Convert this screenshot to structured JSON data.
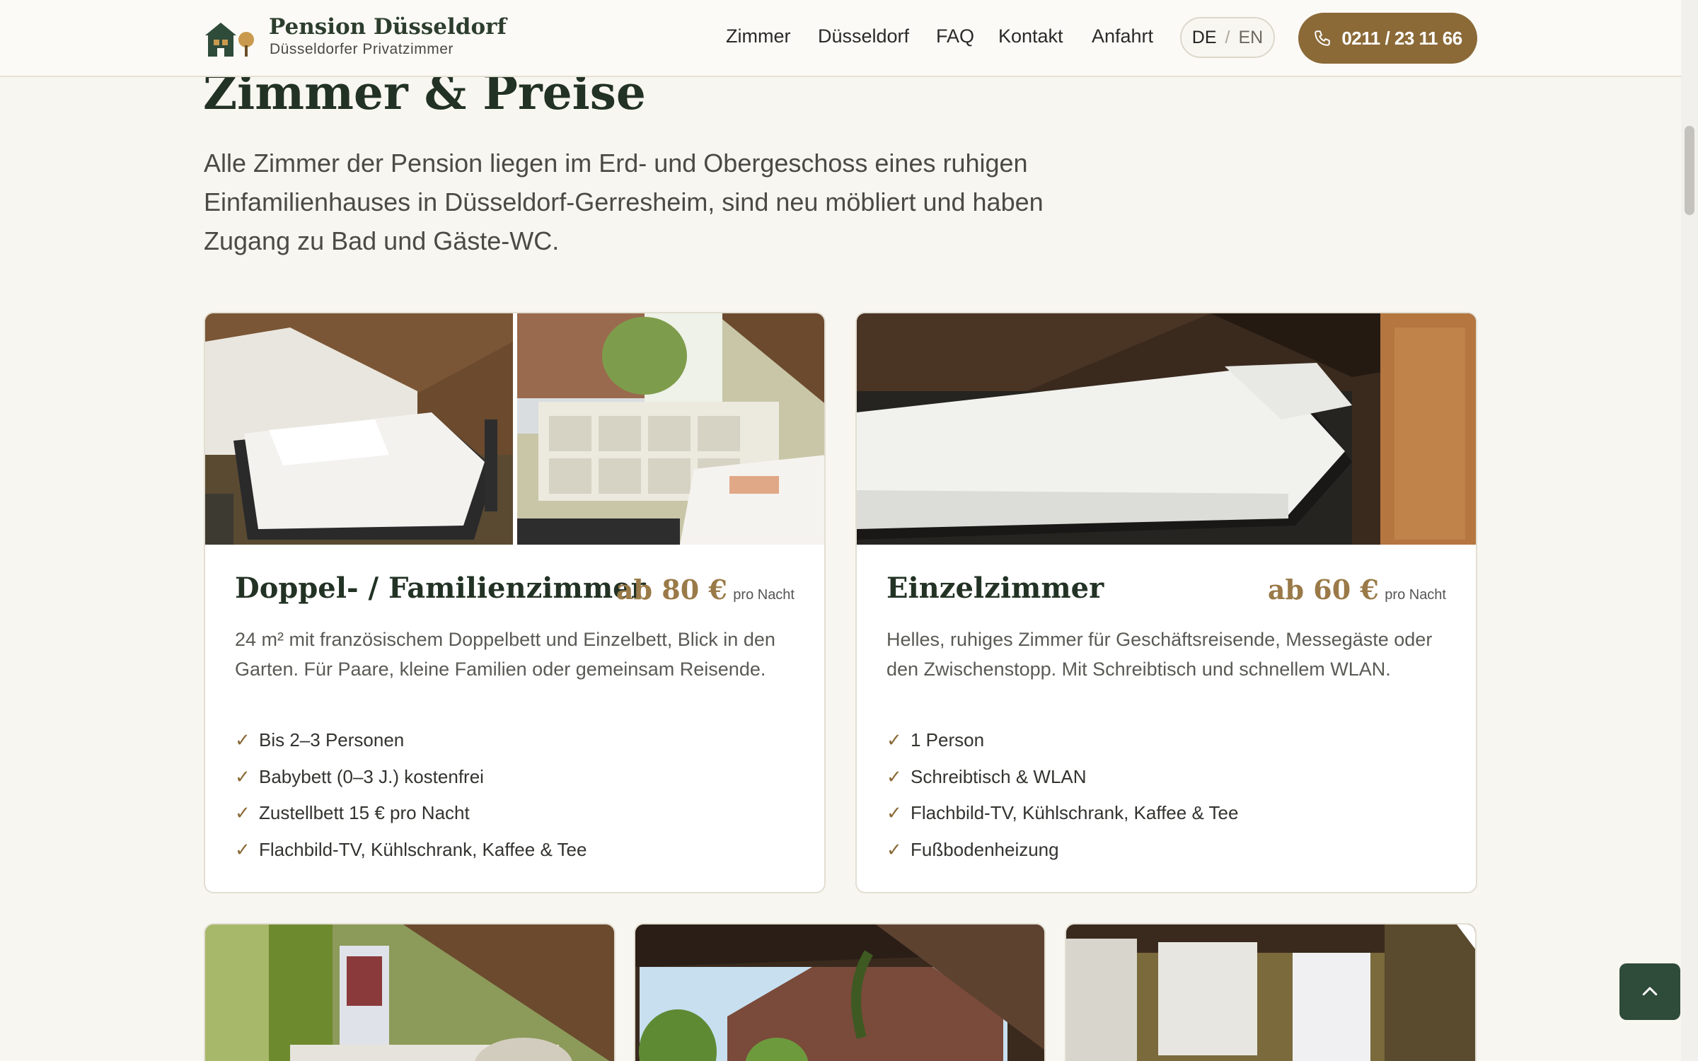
{
  "header": {
    "brand_name": "Pension Düsseldorf",
    "brand_sub": "Düsseldorfer Privatzimmer",
    "nav": [
      "Zimmer",
      "Düsseldorf",
      "FAQ",
      "Kontakt",
      "Anfahrt"
    ],
    "lang_active": "DE",
    "lang_sep": "/",
    "lang_other": "EN",
    "phone": "0211 / 23 11 66"
  },
  "intro": {
    "title": "Zimmer & Preise",
    "text": "Alle Zimmer der Pension liegen im Erd- und Obergeschoss eines ruhigen Einfamilienhauses in Düsseldorf-Gerresheim, sind neu möbliert und haben Zugang zu Bad und Gäste-WC."
  },
  "rooms": [
    {
      "name": "Doppel- / Familienzimmer",
      "price": "ab 80 €",
      "price_unit": "pro Nacht",
      "description": "24 m² mit französischem Doppelbett und Einzelbett, Blick in den Garten. Für Paare, kleine Familien oder gemeinsam Reisende.",
      "features": [
        "Bis 2–3 Personen",
        "Babybett (0–3 J.) kostenfrei",
        "Zustellbett 15 € pro Nacht",
        "Flachbild-TV, Kühlschrank, Kaffee & Tee"
      ]
    },
    {
      "name": "Einzelzimmer",
      "price": "ab 60 €",
      "price_unit": "pro Nacht",
      "description": "Helles, ruhiges Zimmer für Geschäftsreisende, Messegäste oder den Zwischenstopp. Mit Schreibtisch und schnellem WLAN.",
      "features": [
        "1 Person",
        "Schreibtisch & WLAN",
        "Flachbild-TV, Kühlschrank, Kaffee & Tee",
        "Fußbodenheizung"
      ]
    }
  ],
  "colors": {
    "background": "#f8f6f0",
    "accent_brown": "#8b6a38",
    "dark_green": "#223224",
    "back_to_top": "#2f4b3a"
  },
  "icons": [
    "house-logo-icon",
    "phone-icon",
    "check-icon",
    "chevron-up-icon"
  ]
}
